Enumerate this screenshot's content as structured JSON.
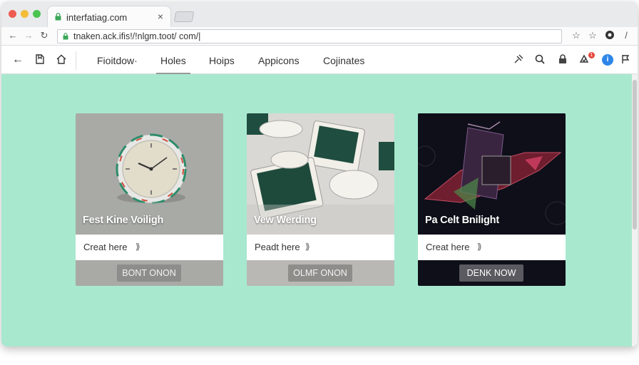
{
  "browser": {
    "tab_title": "interfatiag.com",
    "tab_close": "×",
    "url": "tnaken.ack.ifis!/!nlgm.toot/ com/|"
  },
  "site_nav": {
    "links": [
      "Fioitdow·",
      "Holes",
      "Hoips",
      "Appicons",
      "Cojinates"
    ],
    "active_index": 1,
    "notification_count": "1"
  },
  "cards": [
    {
      "title": "Fest Kine Voiligh",
      "link_text": "Creat here",
      "button_label": "BONT ONON"
    },
    {
      "title": "Vew Werding",
      "link_text": "Peadt here",
      "button_label": "OLMF ONON"
    },
    {
      "title": "Pa Celt Bnilight",
      "link_text": "Creat here",
      "button_label": "DENK NOW"
    }
  ],
  "colors": {
    "main_bg": "#a8e8cf",
    "card1_bg": "#a9aaa6",
    "card2_bg": "#d9d9d5",
    "card3_bg": "#0f0f1a"
  }
}
